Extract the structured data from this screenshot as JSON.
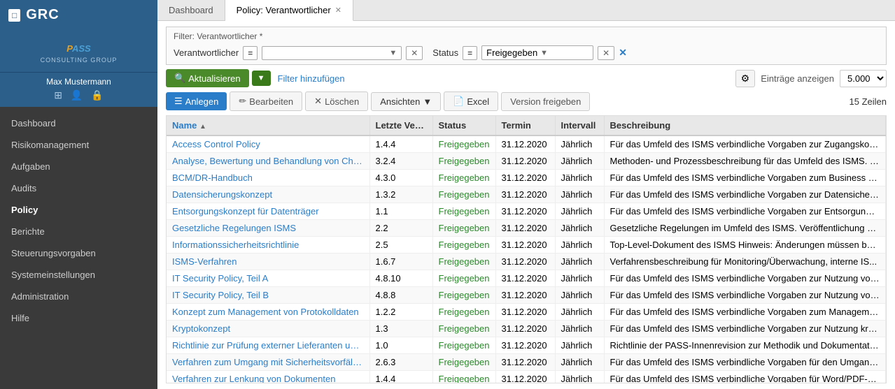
{
  "sidebar": {
    "logo_icon": "□",
    "logo_text": "GRC",
    "pass_text": "PASS",
    "pass_sub": "CONSULTING GROUP",
    "username": "Max Mustermann",
    "nav_items": [
      {
        "label": "Dashboard",
        "active": false
      },
      {
        "label": "Risikomanagement",
        "active": false
      },
      {
        "label": "Aufgaben",
        "active": false
      },
      {
        "label": "Audits",
        "active": false
      },
      {
        "label": "Policy",
        "active": true
      },
      {
        "label": "Berichte",
        "active": false
      },
      {
        "label": "Steuerungsvorgaben",
        "active": false
      },
      {
        "label": "Systemeinstellungen",
        "active": false
      },
      {
        "label": "Administration",
        "active": false
      },
      {
        "label": "Hilfe",
        "active": false
      }
    ]
  },
  "tabs": [
    {
      "label": "Dashboard",
      "active": false,
      "closable": false
    },
    {
      "label": "Policy: Verantwortlicher",
      "active": true,
      "closable": true
    }
  ],
  "filter": {
    "header": "Filter: Verantwortlicher *",
    "verantwortlicher_label": "Verantwortlicher",
    "eq_label": "=",
    "verantwortlicher_placeholder": "",
    "status_label": "Status",
    "status_eq": "=",
    "status_value": "Freigegeben",
    "add_filter_label": "Filter hinzufügen"
  },
  "action_bar": {
    "refresh_label": "Aktualisieren",
    "entries_label": "Einträge anzeigen",
    "entries_value": "5.000"
  },
  "toolbar": {
    "anlegen_label": "Anlegen",
    "edit_label": "Bearbeiten",
    "delete_label": "Löschen",
    "views_label": "Ansichten",
    "excel_label": "Excel",
    "release_label": "Version freigeben",
    "row_count": "15 Zeilen"
  },
  "table": {
    "columns": [
      {
        "key": "name",
        "label": "Name",
        "sorted": true
      },
      {
        "key": "version",
        "label": "Letzte Version"
      },
      {
        "key": "status",
        "label": "Status"
      },
      {
        "key": "termin",
        "label": "Termin"
      },
      {
        "key": "intervall",
        "label": "Intervall"
      },
      {
        "key": "beschreibung",
        "label": "Beschreibung"
      }
    ],
    "rows": [
      {
        "name": "Access Control Policy",
        "version": "1.4.4",
        "status": "Freigegeben",
        "termin": "31.12.2020",
        "intervall": "Jährlich",
        "beschreibung": "Für das Umfeld des ISMS verbindliche Vorgaben zur Zugangskont..."
      },
      {
        "name": "Analyse, Bewertung und Behandlung von Chancen und Risike",
        "version": "3.2.4",
        "status": "Freigegeben",
        "termin": "31.12.2020",
        "intervall": "Jährlich",
        "beschreibung": "Methoden- und Prozessbeschreibung für das Umfeld des ISMS. Ve..."
      },
      {
        "name": "BCM/DR-Handbuch",
        "version": "4.3.0",
        "status": "Freigegeben",
        "termin": "31.12.2020",
        "intervall": "Jährlich",
        "beschreibung": "Für das Umfeld des ISMS verbindliche Vorgaben zum Business Co..."
      },
      {
        "name": "Datensicherungskonzept",
        "version": "1.3.2",
        "status": "Freigegeben",
        "termin": "31.12.2020",
        "intervall": "Jährlich",
        "beschreibung": "Für das Umfeld des ISMS verbindliche Vorgaben zur Datensicheru..."
      },
      {
        "name": "Entsorgungskonzept für Datenträger",
        "version": "1.1",
        "status": "Freigegeben",
        "termin": "31.12.2020",
        "intervall": "Jährlich",
        "beschreibung": "Für das Umfeld des ISMS verbindliche Vorgaben zur Entsorgung/V..."
      },
      {
        "name": "Gesetzliche Regelungen ISMS",
        "version": "2.2",
        "status": "Freigegeben",
        "termin": "31.12.2020",
        "intervall": "Jährlich",
        "beschreibung": "Gesetzliche Regelungen im Umfeld des ISMS. Veröffentlichung üb..."
      },
      {
        "name": "Informationssicherheitsrichtlinie",
        "version": "2.5",
        "status": "Freigegeben",
        "termin": "31.12.2020",
        "intervall": "Jährlich",
        "beschreibung": "Top-Level-Dokument des ISMS Hinweis: Änderungen müssen bei U..."
      },
      {
        "name": "ISMS-Verfahren",
        "version": "1.6.7",
        "status": "Freigegeben",
        "termin": "31.12.2020",
        "intervall": "Jährlich",
        "beschreibung": "Verfahrensbeschreibung für Monitoring/Überwachung, interne IS..."
      },
      {
        "name": "IT Security Policy, Teil A",
        "version": "4.8.10",
        "status": "Freigegeben",
        "termin": "31.12.2020",
        "intervall": "Jährlich",
        "beschreibung": "Für das Umfeld des ISMS verbindliche Vorgaben zur Nutzung von..."
      },
      {
        "name": "IT Security Policy, Teil B",
        "version": "4.8.8",
        "status": "Freigegeben",
        "termin": "31.12.2020",
        "intervall": "Jährlich",
        "beschreibung": "Für das Umfeld des ISMS verbindliche Vorgaben zur Nutzung von..."
      },
      {
        "name": "Konzept zum Management von Protokolldaten",
        "version": "1.2.2",
        "status": "Freigegeben",
        "termin": "31.12.2020",
        "intervall": "Jährlich",
        "beschreibung": "Für das Umfeld des ISMS verbindliche Vorgaben zum Manageme..."
      },
      {
        "name": "Kryptokonzept",
        "version": "1.3",
        "status": "Freigegeben",
        "termin": "31.12.2020",
        "intervall": "Jährlich",
        "beschreibung": "Für das Umfeld des ISMS verbindliche Vorgaben zur Nutzung kryp..."
      },
      {
        "name": "Richtlinie zur Prüfung externer Lieferanten und Dienstleister",
        "version": "1.0",
        "status": "Freigegeben",
        "termin": "31.12.2020",
        "intervall": "Jährlich",
        "beschreibung": "Richtlinie der PASS-Innenrevision zur Methodik und Dokumentatio..."
      },
      {
        "name": "Verfahren zum Umgang mit Sicherheitsvorfällen",
        "version": "2.6.3",
        "status": "Freigegeben",
        "termin": "31.12.2020",
        "intervall": "Jährlich",
        "beschreibung": "Für das Umfeld des ISMS verbindliche Vorgaben für den Umgang..."
      },
      {
        "name": "Verfahren zur Lenkung von Dokumenten",
        "version": "1.4.4",
        "status": "Freigegeben",
        "termin": "31.12.2020",
        "intervall": "Jährlich",
        "beschreibung": "Für das Umfeld des ISMS verbindliche Vorgaben für Word/PDF-Do..."
      }
    ]
  }
}
